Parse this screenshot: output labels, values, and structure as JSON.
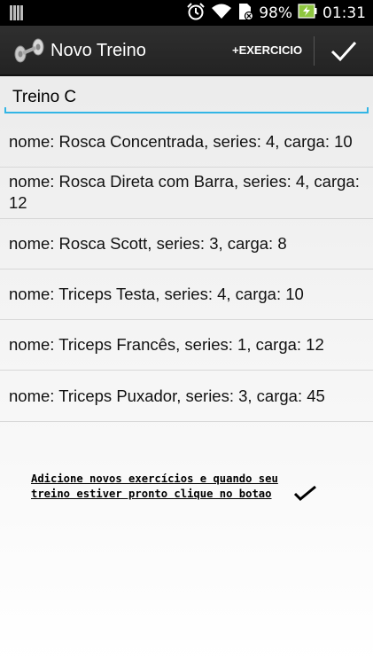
{
  "status_bar": {
    "battery_percent": "98%",
    "time": "01:31"
  },
  "action_bar": {
    "title": "Novo Treino",
    "add_exercise_label": "+EXERCICIO"
  },
  "workout_name": {
    "value": "Treino C"
  },
  "exercises": [
    "nome: Rosca Concentrada, series: 4, carga: 10",
    "nome: Rosca Direta com Barra, series: 4, carga: 12",
    "nome: Rosca Scott, series: 3, carga: 8",
    "nome: Triceps Testa, series: 4, carga: 10",
    "nome: Triceps Francês, series: 1, carga: 12",
    "nome: Triceps Puxador, series: 3, carga: 45"
  ],
  "hint": {
    "text": "Adicione novos exercícios e quando seu treino estiver pronto clique no botao"
  },
  "colors": {
    "accent": "#33b5e5",
    "action_bar": "#2a2a2a",
    "battery": "#8ec63f"
  },
  "icons": [
    "signal-bars-icon",
    "alarm-icon",
    "wifi-icon",
    "sd-card-icon",
    "battery-charging-icon",
    "dumbbell-app-icon",
    "checkmark-icon"
  ]
}
